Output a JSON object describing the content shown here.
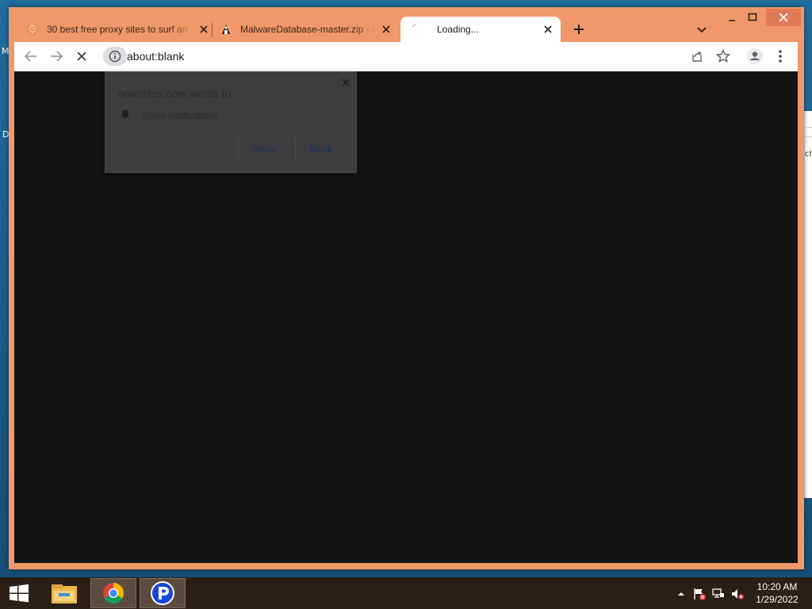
{
  "desktop": {
    "edge_letters": [
      "M",
      "D",
      "ch"
    ]
  },
  "browser": {
    "tabs": [
      {
        "title": "30 best free proxy sites to surf an",
        "favicon": "proxy-site-favicon",
        "state": "inactive"
      },
      {
        "title": "MalwareDatabase-master.zip - A",
        "favicon": "anonfiles-favicon",
        "state": "inactive"
      },
      {
        "title": "Loading...",
        "favicon": "loading-spinner-icon",
        "state": "active"
      }
    ],
    "address": {
      "url": "about:blank"
    },
    "permission_popup": {
      "title": "anonfiles.com wants to",
      "permission": "Show notifications",
      "allow_label": "Allow",
      "block_label": "Block"
    }
  },
  "taskbar": {
    "apps": [
      "start-button",
      "file-explorer-icon",
      "chrome-icon",
      "parking-p-icon"
    ],
    "clock": {
      "time": "10:20 AM",
      "date": "1/29/2022"
    }
  },
  "colors": {
    "window_frame": "#f0986a",
    "page_background": "#131313",
    "taskbar": "#2b2016"
  }
}
